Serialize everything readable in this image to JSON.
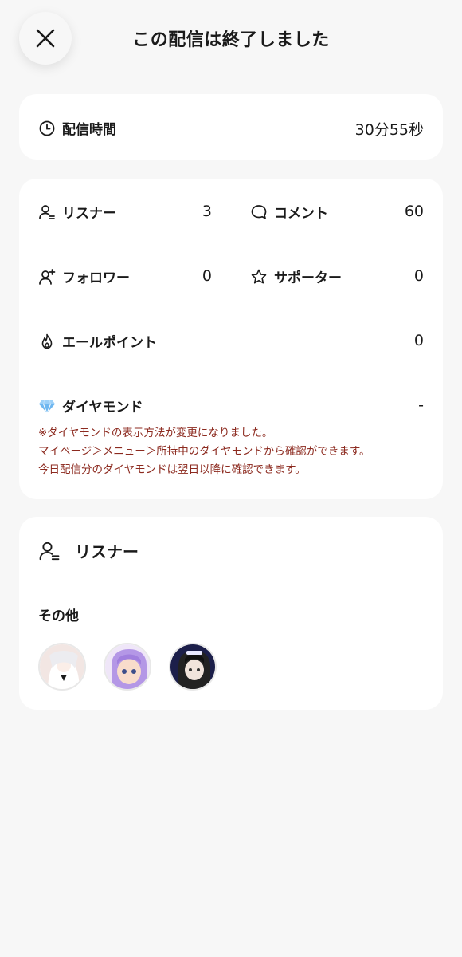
{
  "header": {
    "title": "この配信は終了しました",
    "close_icon": "close-icon"
  },
  "duration": {
    "label": "配信時間",
    "value": "30分55秒",
    "icon": "clock-icon"
  },
  "stats": {
    "listeners": {
      "label": "リスナー",
      "value": "3",
      "icon": "listener-icon"
    },
    "comments": {
      "label": "コメント",
      "value": "60",
      "icon": "comment-bubble-icon"
    },
    "followers": {
      "label": "フォロワー",
      "value": "0",
      "icon": "add-person-icon"
    },
    "supporters": {
      "label": "サポーター",
      "value": "0",
      "icon": "star-icon"
    },
    "yell_points": {
      "label": "エールポイント",
      "value": "0",
      "icon": "flame-icon"
    },
    "diamonds": {
      "label": "ダイヤモンド",
      "value": "-",
      "icon": "diamond-icon"
    },
    "notice_lines": [
      "※ダイヤモンドの表示方法が変更になりました。",
      "マイページ＞メニュー＞所持中のダイヤモンドから確認ができます。",
      "今日配信分のダイヤモンドは翌日以降に確認できます。"
    ],
    "notice_color": "#8c2a1f"
  },
  "listeners_section": {
    "title": "リスナー",
    "icon": "listener-icon",
    "other_label": "その他",
    "avatars": [
      {
        "name": "listener-avatar-1",
        "colors": [
          "#f3e7e4",
          "#ffffff"
        ]
      },
      {
        "name": "listener-avatar-2",
        "colors": [
          "#b79be8",
          "#f6d9c6"
        ]
      },
      {
        "name": "listener-avatar-3",
        "colors": [
          "#1c1f4a",
          "#2b2b2b"
        ]
      }
    ]
  }
}
